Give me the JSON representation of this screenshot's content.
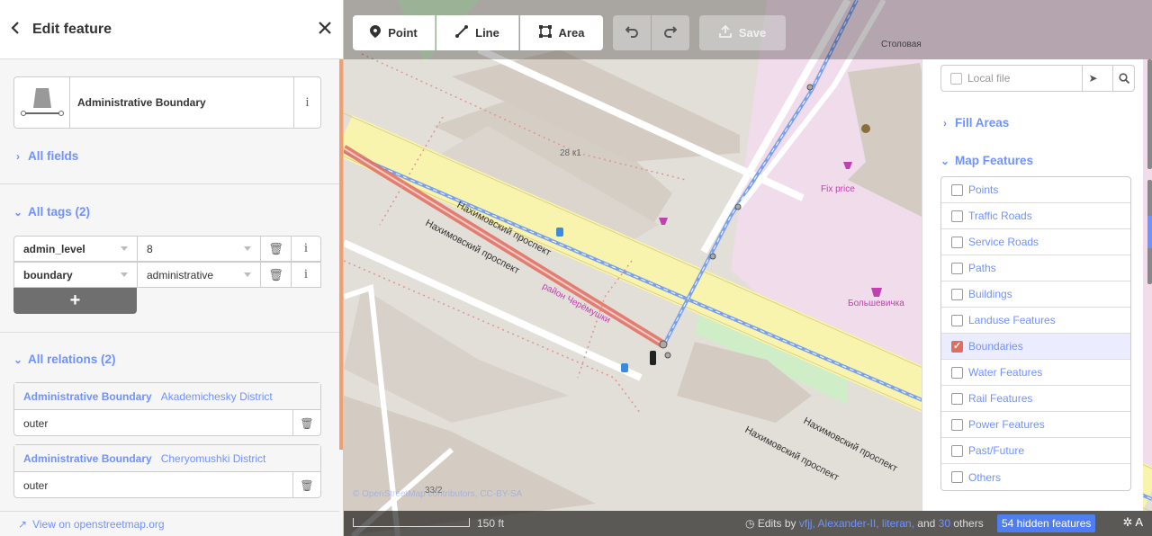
{
  "sidebar": {
    "header_title": "Edit feature",
    "preset_name": "Administrative Boundary",
    "all_fields": "All fields",
    "all_tags": "All tags (2)",
    "tags": [
      {
        "key": "admin_level",
        "value": "8"
      },
      {
        "key": "boundary",
        "value": "administrative"
      }
    ],
    "add_tag": "+",
    "all_relations": "All relations (2)",
    "relations": [
      {
        "type": "Administrative Boundary",
        "name": "Akademichesky District",
        "role": "outer"
      },
      {
        "type": "Administrative Boundary",
        "name": "Cheryomushki District",
        "role": "outer"
      }
    ],
    "view_osm": "View on openstreetmap.org"
  },
  "toolbar": {
    "point": "Point",
    "line": "Line",
    "area": "Area",
    "save": "Save"
  },
  "map_data": {
    "search_placeholder": "Local file",
    "fill_areas": "Fill Areas",
    "map_features": "Map Features",
    "features": [
      {
        "label": "Points",
        "checked": false
      },
      {
        "label": "Traffic Roads",
        "checked": false
      },
      {
        "label": "Service Roads",
        "checked": false
      },
      {
        "label": "Paths",
        "checked": false
      },
      {
        "label": "Buildings",
        "checked": false
      },
      {
        "label": "Landuse Features",
        "checked": false
      },
      {
        "label": "Boundaries",
        "checked": true
      },
      {
        "label": "Water Features",
        "checked": false
      },
      {
        "label": "Rail Features",
        "checked": false
      },
      {
        "label": "Power Features",
        "checked": false
      },
      {
        "label": "Past/Future",
        "checked": false
      },
      {
        "label": "Others",
        "checked": false
      }
    ]
  },
  "map_labels": {
    "building_number": "28 к1",
    "building_number_2": "33/2",
    "street_1": "Нахимовский проспект",
    "street_2": "Нахимовский проспект",
    "street_3": "Нахимовский проспект",
    "street_4": "Нахимовский проспект",
    "district": "район Черёмушки",
    "fix_price": "Fix price",
    "cafe": "Столовая",
    "shop": "Большевичка",
    "attribution": "© OpenStreetMap contributors, CC-BY-SA"
  },
  "footer": {
    "scale": "150 ft",
    "edits_prefix": "Edits by",
    "editors": "vfjj, Alexander-II, literan,",
    "edits_and": "and",
    "others_count": "30",
    "edits_others": "others",
    "hidden_features": "54 hidden features"
  },
  "colors": {
    "accent": "#7092ff",
    "boundary": "#e06d5f",
    "road": "#f8f4ad"
  }
}
